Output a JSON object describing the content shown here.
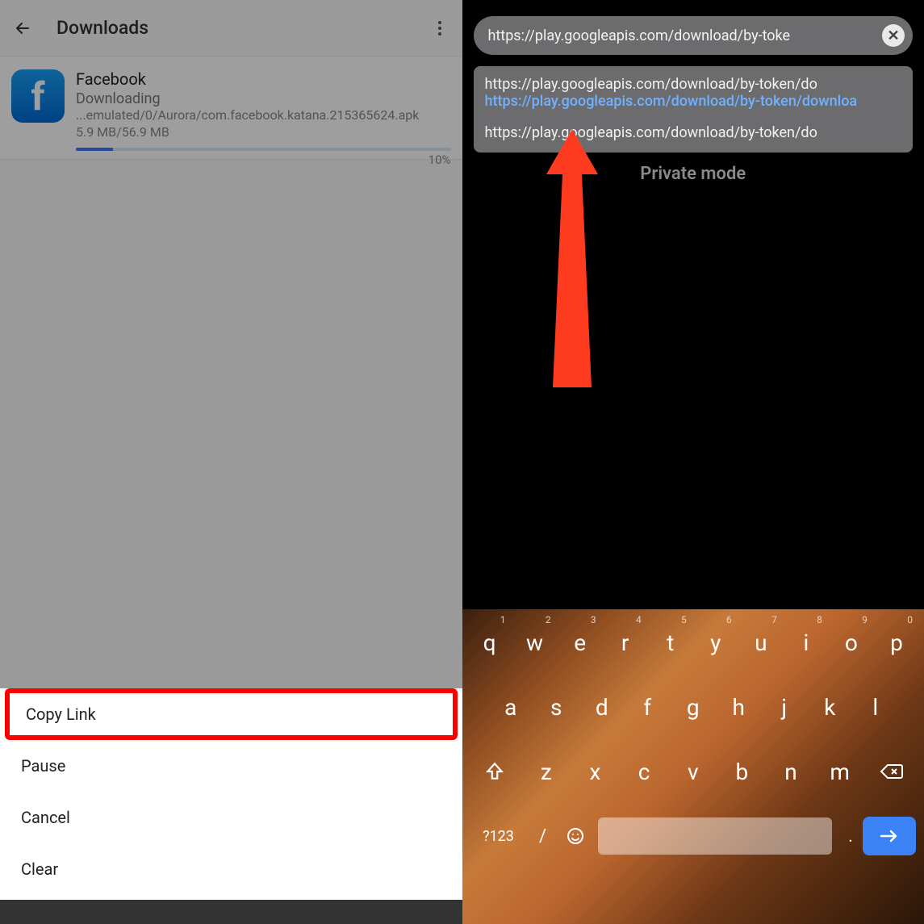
{
  "left": {
    "header": {
      "title": "Downloads"
    },
    "download": {
      "app_name": "Facebook",
      "status": "Downloading",
      "path": "...emulated/0/Aurora/com.facebook.katana.215365624.apk",
      "size": "5.9 MB/56.9 MB",
      "percent": "10%",
      "progress_percent": 10
    },
    "menu": {
      "copy_link": "Copy Link",
      "pause": "Pause",
      "cancel": "Cancel",
      "clear": "Clear"
    }
  },
  "right": {
    "url_input": "https://play.googleapis.com/download/by-toke",
    "suggestions": {
      "row1": "https://play.googleapis.com/download/by-token/do",
      "row1_sel": "https://play.googleapis.com/download/by-token/downloa",
      "row2": "https://play.googleapis.com/download/by-token/do"
    },
    "private_label": "Private mode",
    "keyboard": {
      "row1": [
        "q",
        "w",
        "e",
        "r",
        "t",
        "y",
        "u",
        "i",
        "o",
        "p"
      ],
      "row1_sup": [
        "1",
        "2",
        "3",
        "4",
        "5",
        "6",
        "7",
        "8",
        "9",
        "0"
      ],
      "row2": [
        "a",
        "s",
        "d",
        "f",
        "g",
        "h",
        "j",
        "k",
        "l"
      ],
      "row3": [
        "z",
        "x",
        "c",
        "v",
        "b",
        "n",
        "m"
      ],
      "sym_label": "?123",
      "slash": "/",
      "dot": "."
    }
  }
}
